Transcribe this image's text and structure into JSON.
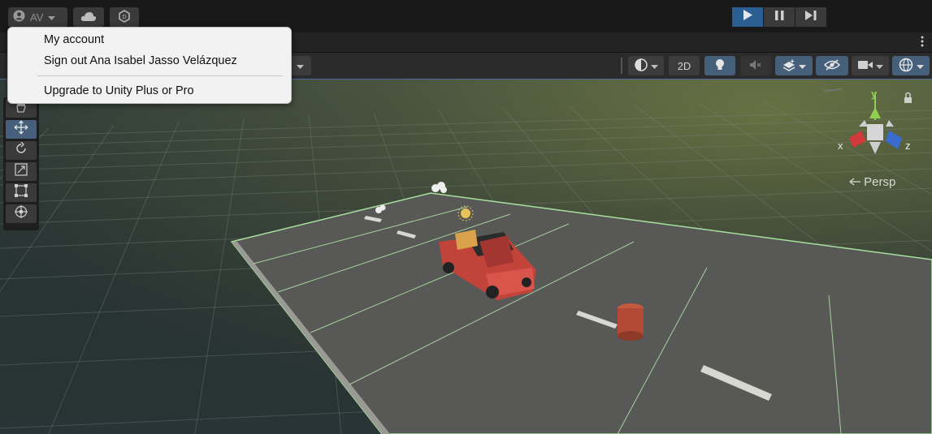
{
  "toolbar": {
    "account_label": "AV",
    "cloud_icon": "cloud-icon",
    "collab_icon": "unity-services-icon"
  },
  "play_controls": {
    "play_icon": "play-icon",
    "pause_icon": "pause-icon",
    "step_icon": "step-icon"
  },
  "scene_toolbar": {
    "mode_2d_label": "2D",
    "lighting_icon": "bulb-icon",
    "audio_icon": "audio-mute-icon",
    "effects_icon": "effects-icon",
    "visibility_icon": "hidden-eye-icon",
    "camera_icon": "camera-icon",
    "gizmos_icon": "gizmos-globe-icon"
  },
  "scene_view": {
    "gizmo": {
      "x_label": "x",
      "y_label": "y",
      "z_label": "z"
    },
    "projection_label": "Persp"
  },
  "account_menu": {
    "items": [
      {
        "label": "My account"
      },
      {
        "label": "Sign out Ana Isabel Jasso Velázquez"
      },
      {
        "label": "Upgrade to Unity Plus or Pro"
      }
    ]
  },
  "colors": {
    "accent": "#2b5f93",
    "selected_tool": "#46607c",
    "axis_x": "#d13a3a",
    "axis_y": "#8fd14f",
    "axis_z": "#3a6bd1"
  }
}
